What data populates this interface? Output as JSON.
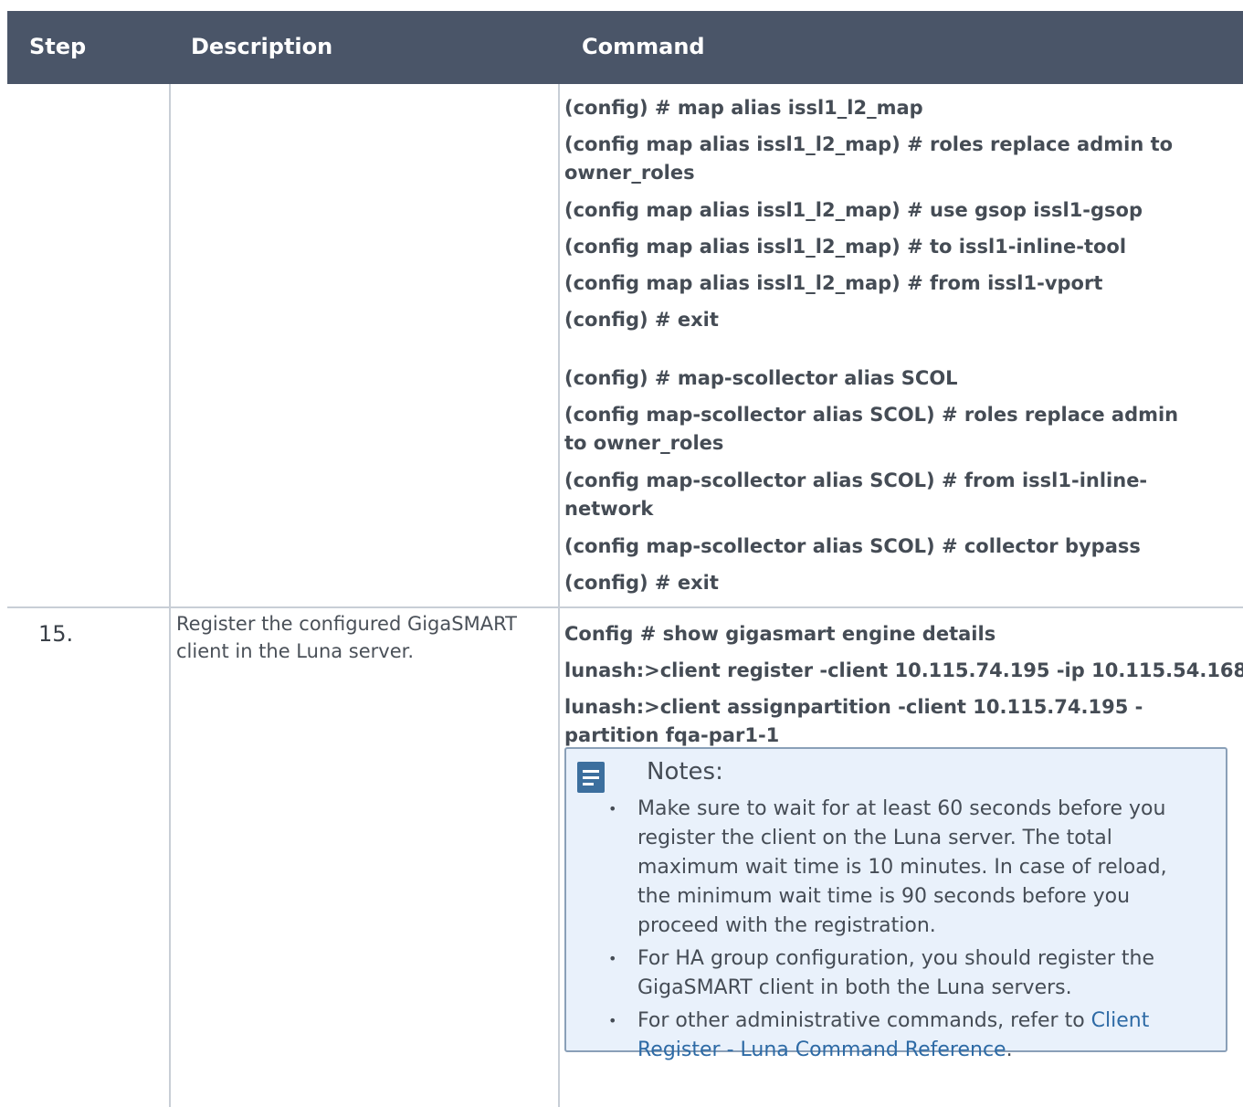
{
  "header": {
    "step": "Step",
    "description": "Description",
    "command": "Command"
  },
  "row1": {
    "commands_a": [
      "(config) # map alias issl1_l2_map",
      "(config map alias issl1_l2_map) # roles replace admin to",
      "owner_roles",
      "(config map alias issl1_l2_map) # use gsop issl1-gsop",
      "(config map alias issl1_l2_map) # to issl1-inline-tool",
      "(config map alias issl1_l2_map) # from issl1-vport",
      "(config) # exit"
    ],
    "commands_b": [
      "(config) # map-scollector alias SCOL",
      "(config map-scollector alias SCOL) # roles replace admin",
      "to owner_roles",
      "(config map-scollector alias SCOL) # from issl1-inline-",
      "network",
      "(config map-scollector alias SCOL) # collector bypass",
      "(config) # exit"
    ]
  },
  "row2": {
    "step": "15.",
    "description": "Register the configured GigaSMART client in the Luna server.",
    "commands": [
      "Config # show gigasmart engine details",
      "lunash:>client register -client 10.115.74.195 -ip 10.115.54.168",
      "lunash:>client assignpartition -client 10.115.74.195 -",
      "partition fqa-par1-1"
    ],
    "notes": {
      "title": "Notes:",
      "item1": "Make sure to wait for at least 60 seconds before you register the client on the Luna server. The total maximum wait time is 10 minutes. In case of reload, the minimum wait time is 90 seconds before you proceed with the registration.",
      "item2": "For HA group configuration, you should register the GigaSMART client in both the Luna servers.",
      "item3_prefix": "For other administrative commands, refer to ",
      "item3_link": "Client Register - Luna Command Reference",
      "item3_suffix": "."
    }
  }
}
